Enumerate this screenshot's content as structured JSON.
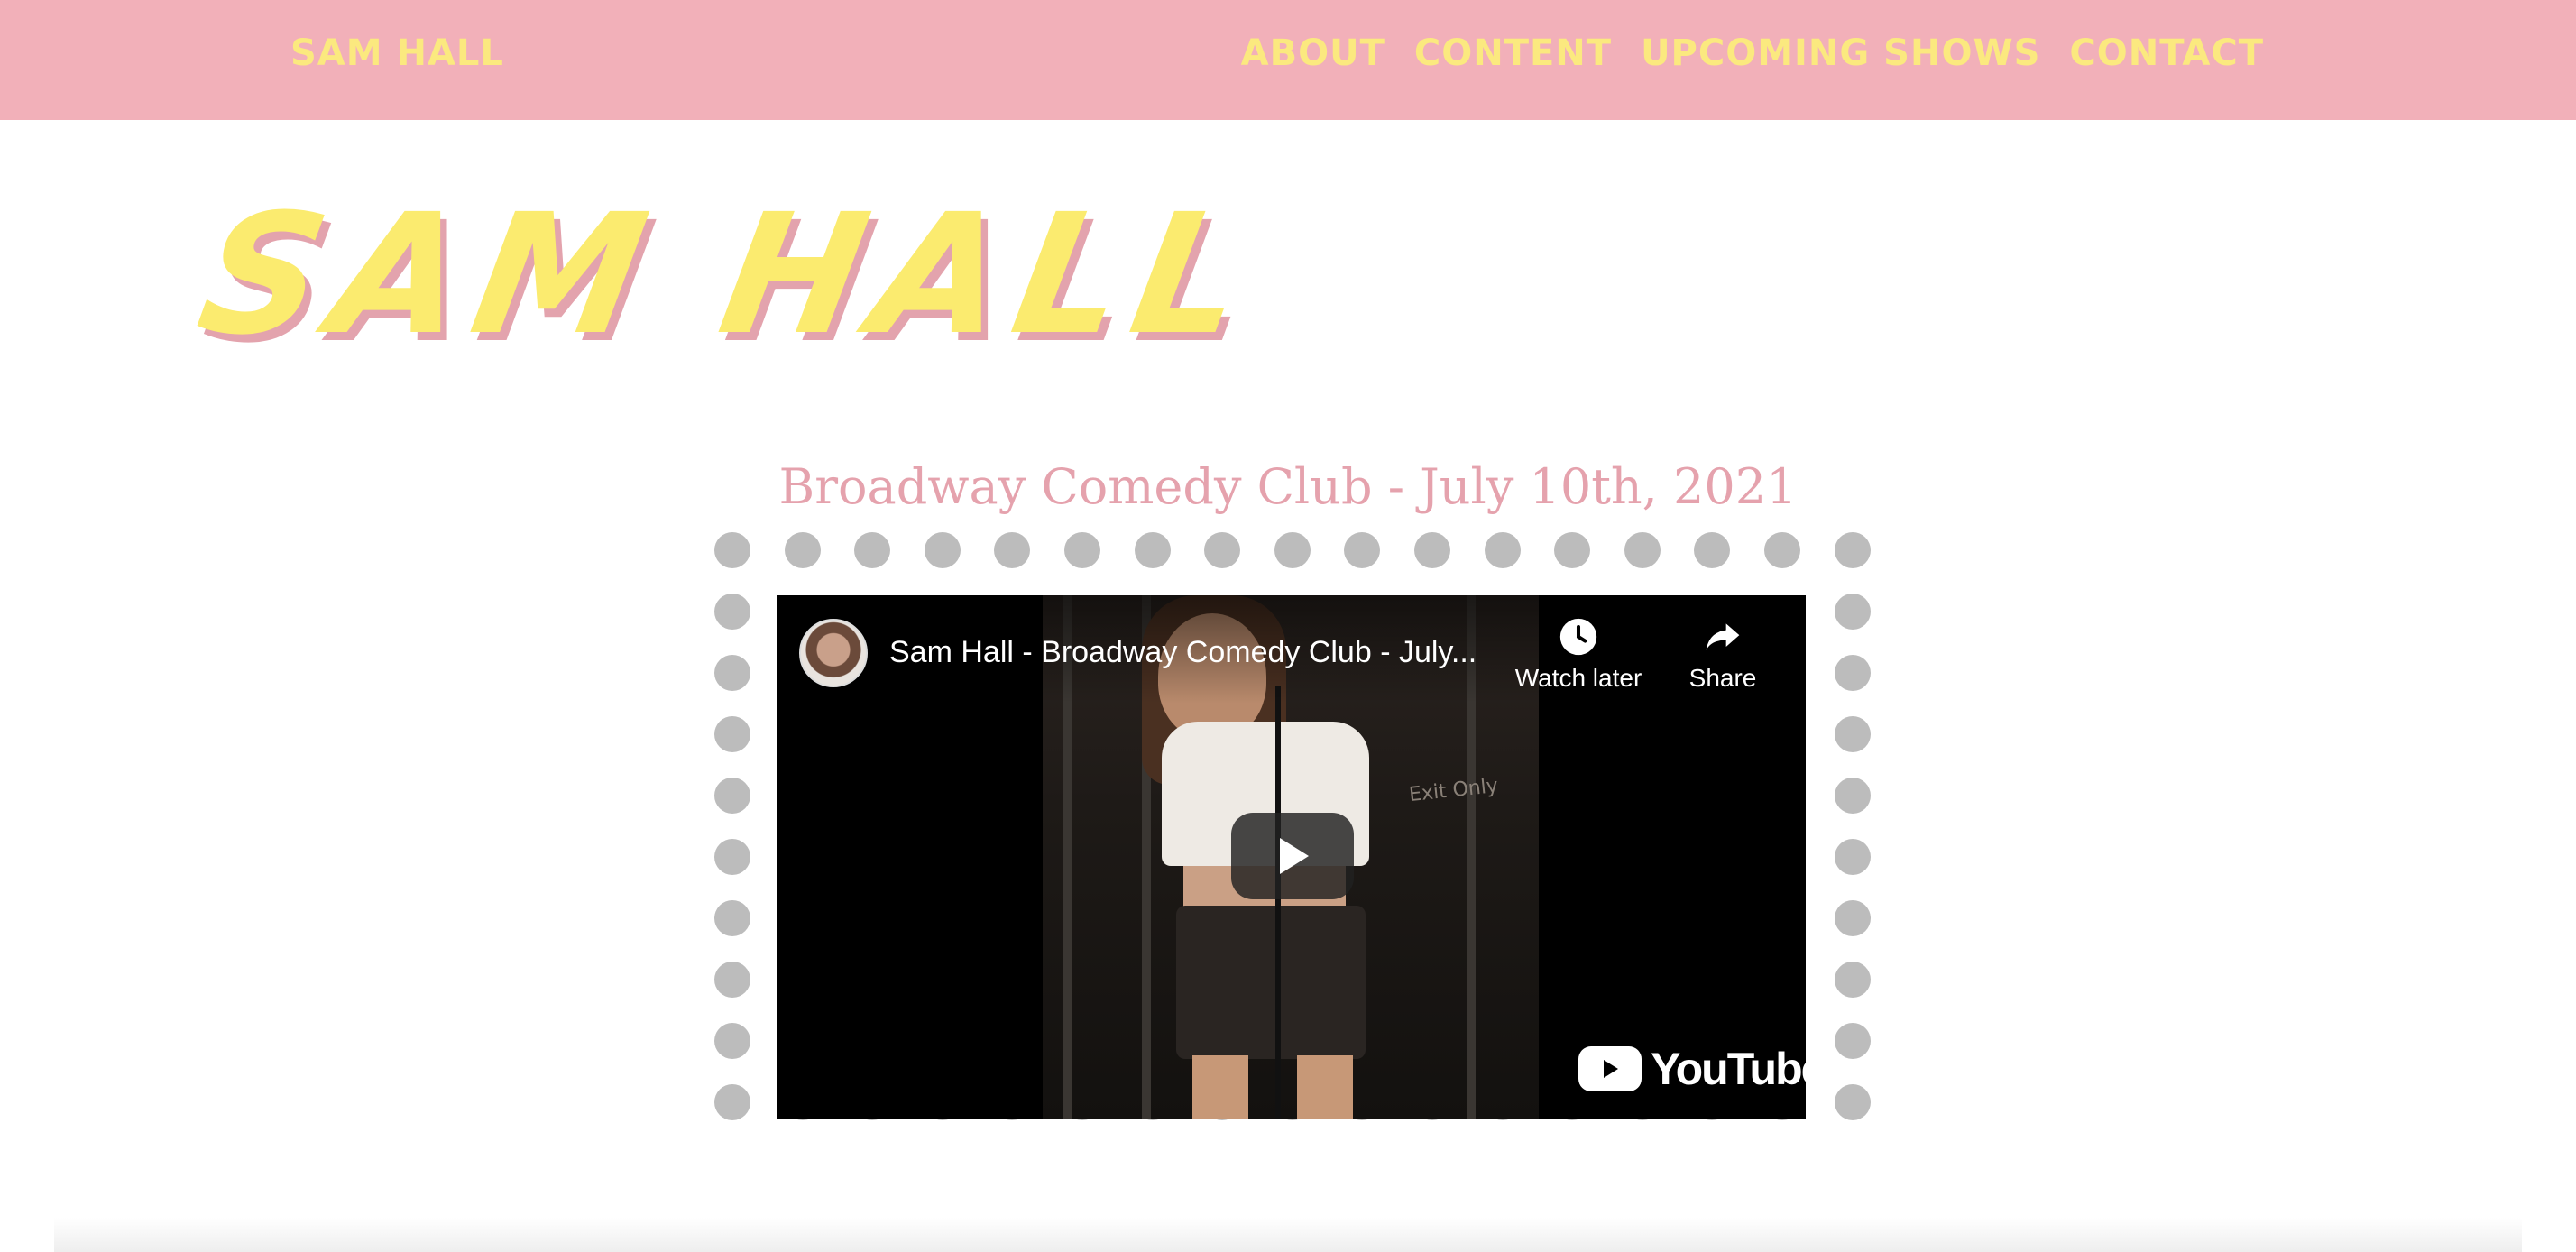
{
  "nav": {
    "brand": "SAM HALL",
    "links": [
      "ABOUT",
      "CONTENT",
      "UPCOMING SHOWS",
      "CONTACT"
    ]
  },
  "hero": {
    "title": "SAM HALL"
  },
  "show": {
    "heading": "Broadway Comedy Club - July 10th, 2021",
    "video": {
      "title": "Sam Hall - Broadway Comedy Club - July...",
      "watch_later": "Watch later",
      "share": "Share",
      "exit_sign": "Exit Only",
      "logo_text": "YouTube"
    }
  },
  "colors": {
    "nav_bg": "#f2b0b9",
    "nav_text": "#fbe97f",
    "hero_yellow": "#fbeb6f",
    "hero_shadow_pink": "#e3a3ad",
    "heading_pink": "#e5a2ad",
    "frame_dot_gray": "#bcbcbc"
  },
  "icons": [
    "clock-icon",
    "share-arrow-icon",
    "play-icon",
    "youtube-logo-icon"
  ]
}
